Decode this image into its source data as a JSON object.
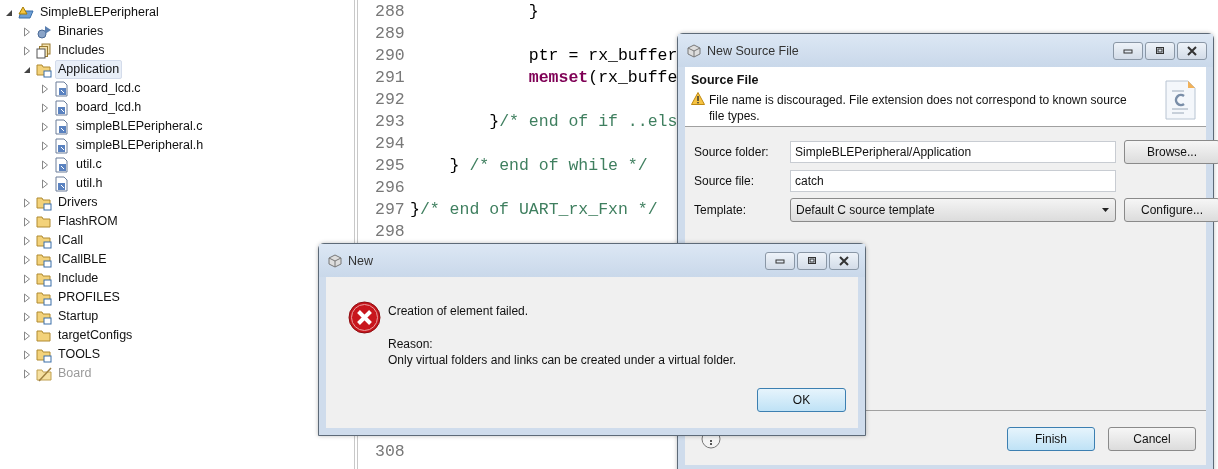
{
  "project_tree": {
    "items": [
      {
        "label": "SimpleBLEPeripheral",
        "kind": "project",
        "expanded": true,
        "selected": false,
        "disabled": false,
        "children": [
          {
            "label": "Binaries",
            "kind": "binaries",
            "expanded": false,
            "selected": false,
            "disabled": false
          },
          {
            "label": "Includes",
            "kind": "includes",
            "expanded": false,
            "selected": false,
            "disabled": false
          },
          {
            "label": "Application",
            "kind": "source-folder",
            "expanded": true,
            "selected": true,
            "disabled": false,
            "children": [
              {
                "label": "board_lcd.c",
                "kind": "c-file",
                "expanded": false,
                "selected": false,
                "disabled": false
              },
              {
                "label": "board_lcd.h",
                "kind": "h-file",
                "expanded": false,
                "selected": false,
                "disabled": false
              },
              {
                "label": "simpleBLEPeripheral.c",
                "kind": "c-file",
                "expanded": false,
                "selected": false,
                "disabled": false
              },
              {
                "label": "simpleBLEPeripheral.h",
                "kind": "h-file",
                "expanded": false,
                "selected": false,
                "disabled": false
              },
              {
                "label": "util.c",
                "kind": "c-file",
                "expanded": false,
                "selected": false,
                "disabled": false
              },
              {
                "label": "util.h",
                "kind": "h-file",
                "expanded": false,
                "selected": false,
                "disabled": false
              }
            ]
          },
          {
            "label": "Drivers",
            "kind": "source-folder",
            "expanded": false,
            "selected": false,
            "disabled": false
          },
          {
            "label": "FlashROM",
            "kind": "folder",
            "expanded": false,
            "selected": false,
            "disabled": false
          },
          {
            "label": "ICall",
            "kind": "source-folder",
            "expanded": false,
            "selected": false,
            "disabled": false
          },
          {
            "label": "ICallBLE",
            "kind": "source-folder",
            "expanded": false,
            "selected": false,
            "disabled": false
          },
          {
            "label": "Include",
            "kind": "source-folder",
            "expanded": false,
            "selected": false,
            "disabled": false
          },
          {
            "label": "PROFILES",
            "kind": "source-folder",
            "expanded": false,
            "selected": false,
            "disabled": false
          },
          {
            "label": "Startup",
            "kind": "source-folder",
            "expanded": false,
            "selected": false,
            "disabled": false
          },
          {
            "label": "targetConfigs",
            "kind": "folder",
            "expanded": false,
            "selected": false,
            "disabled": false
          },
          {
            "label": "TOOLS",
            "kind": "source-folder",
            "expanded": false,
            "selected": false,
            "disabled": false
          },
          {
            "label": "Board",
            "kind": "excluded-folder",
            "expanded": false,
            "selected": false,
            "disabled": true
          }
        ]
      }
    ]
  },
  "editor": {
    "lines": [
      {
        "number": "288",
        "segments": [
          {
            "kind": "plain",
            "text": "            }"
          }
        ]
      },
      {
        "number": "289"
      },
      {
        "number": "290",
        "segments": [
          {
            "kind": "plain",
            "text": "            ptr = rx_buffer"
          }
        ]
      },
      {
        "number": "291",
        "segments": [
          {
            "kind": "keyword",
            "text": "            memset"
          },
          {
            "kind": "plain",
            "text": "(rx_buffe"
          }
        ]
      },
      {
        "number": "292"
      },
      {
        "number": "293",
        "segments": [
          {
            "kind": "plain",
            "text": "        }"
          },
          {
            "kind": "comment",
            "text": "/* end of if ..els"
          }
        ]
      },
      {
        "number": "294"
      },
      {
        "number": "295",
        "segments": [
          {
            "kind": "plain",
            "text": "    } "
          },
          {
            "kind": "comment",
            "text": "/* end of while */"
          }
        ]
      },
      {
        "number": "296"
      },
      {
        "number": "297",
        "segments": [
          {
            "kind": "plain",
            "text": "}"
          },
          {
            "kind": "comment",
            "text": "/* end of UART_rx_Fxn */"
          }
        ]
      },
      {
        "number": "298"
      },
      {
        "number": "308"
      }
    ]
  },
  "source_dialog": {
    "title": "New Source File",
    "heading": "Source File",
    "message": "File name is discouraged. File extension does not correspond to known source file types.",
    "fields": [
      {
        "label": "Source folder:",
        "kind": "text",
        "value": "SimpleBLEPeripheral/Application",
        "button": "Browse..."
      },
      {
        "label": "Source file:",
        "kind": "text",
        "value": "catch"
      },
      {
        "label": "Template:",
        "kind": "dropdown",
        "value": "Default C source template",
        "button": "Configure..."
      }
    ],
    "buttons": [
      {
        "label": "Finish",
        "default": true
      },
      {
        "label": "Cancel",
        "default": false
      }
    ]
  },
  "error_dialog": {
    "title": "New",
    "message": "Creation of element failed.",
    "reason_label": "Reason:",
    "reason": "Only virtual folders and links can be created under a virtual folder.",
    "buttons": [
      {
        "label": "OK",
        "default": true
      }
    ]
  }
}
